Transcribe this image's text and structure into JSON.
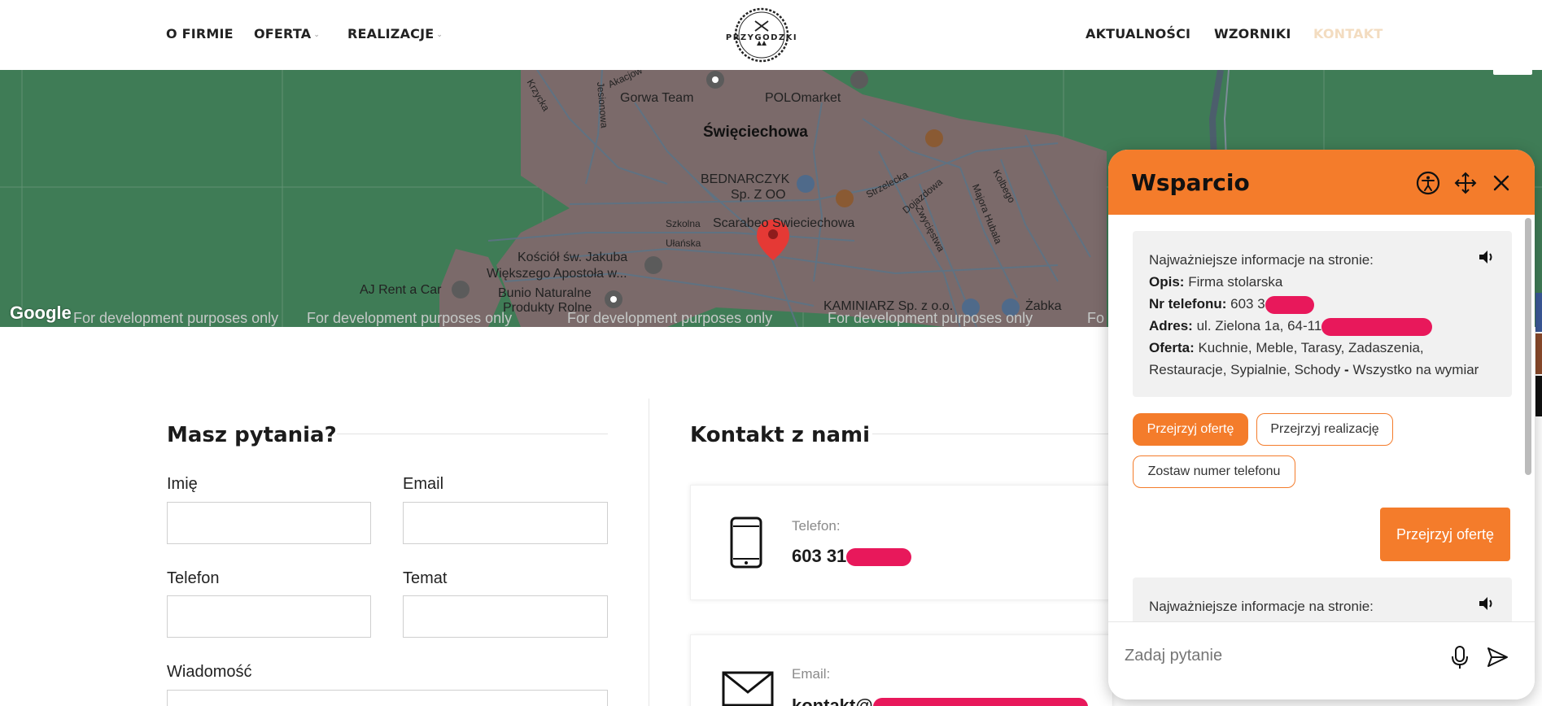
{
  "nav": {
    "left": [
      {
        "label": "O FIRMIE",
        "dropdown": false
      },
      {
        "label": "OFERTA",
        "dropdown": true
      },
      {
        "label": "REALIZACJE",
        "dropdown": true
      }
    ],
    "right": [
      {
        "label": "AKTUALNOŚCI"
      },
      {
        "label": "WZORNIKI"
      },
      {
        "label": "KONTAKT"
      }
    ],
    "logo_text": "PRZYGODZKI",
    "active_color": "#f3dcc0"
  },
  "map": {
    "labels": {
      "town": "Święciechowa",
      "krzycka": "Krzycka",
      "jesionowa": "Jesionowa",
      "akacjowa": "Akacjow",
      "gorwa": "Gorwa Team",
      "polomarket": "POLOmarket",
      "bednarczyk1": "BEDNARCZYK",
      "bednarczyk2": "Sp. Z OO",
      "strzelecka": "Strzelecka",
      "dojazdowa": "Dojazdowa",
      "zwyciestwa": "Zwycięstwa",
      "majora": "Majora Hubala",
      "kolbego": "Kolbego",
      "szkolna": "Szkolna",
      "ulanska": "Ułańska",
      "scarabeo": "Scarabeo Swieciechowa",
      "kosciol1": "Kościół św. Jakuba",
      "kosciol2": "Większego Apostoła w...",
      "ajrent": "AJ Rent a Car",
      "bunio1": "Bunio Naturalne",
      "bunio2": "Produkty Rolne",
      "kaminiarz": "KAMINIARZ Sp. z o.o.",
      "zabka": "Żabka"
    },
    "dev_notice": "For development purposes only",
    "dev_notice_last": "Fo",
    "google_logo": "Google",
    "colors": {
      "land": "#3f7c56",
      "town": "#7b6a6a",
      "road": "#5d6f80",
      "pin": "#e53935"
    }
  },
  "form": {
    "title": "Masz pytania?",
    "fields": {
      "name": "Imię",
      "email": "Email",
      "phone": "Telefon",
      "subject": "Temat",
      "message": "Wiadomość"
    }
  },
  "contact": {
    "title": "Kontakt z nami",
    "phone_label": "Telefon:",
    "phone_value": "603 31",
    "email_label": "Email:",
    "email_value": "kontakt@"
  },
  "chat": {
    "title": "Wsparcio",
    "accent": "#f47c2b",
    "message1": {
      "intro": "Najważniejsze informacje na stronie:",
      "opis_label": "Opis:",
      "opis_value": "Firma stolarska",
      "phone_label": "Nr telefonu:",
      "phone_value": "603 3",
      "address_label": "Adres:",
      "address_value": "ul. Zielona 1a, 64-11",
      "offer_label": "Oferta:",
      "offer_value": "Kuchnie, Meble, Tarasy, Zadaszenia, Restauracje, Sypialnie, Schody",
      "offer_suffix": "Wszystko na wymiar"
    },
    "chips": {
      "offer": "Przejrzyj ofertę",
      "realizations": "Przejrzyj realizację",
      "leave_phone": "Zostaw numer telefonu"
    },
    "user_message": "Przejrzyj ofertę",
    "message2_intro": "Najważniejsze informacje na stronie:",
    "input_placeholder": "Zadaj pytanie"
  }
}
